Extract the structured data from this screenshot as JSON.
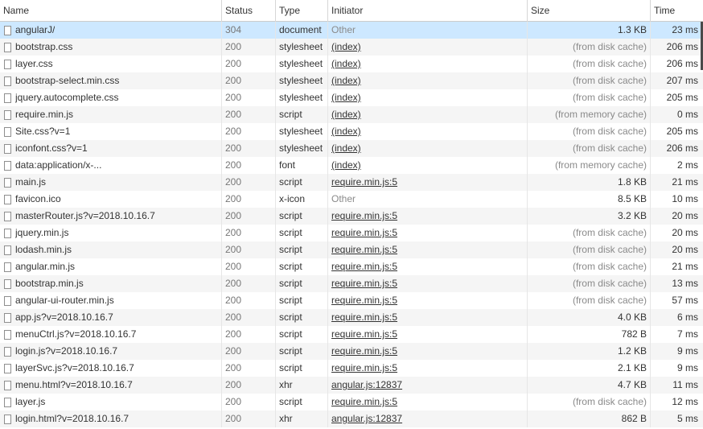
{
  "columns": {
    "name": "Name",
    "status": "Status",
    "type": "Type",
    "initiator": "Initiator",
    "size": "Size",
    "time": "Time"
  },
  "rows": [
    {
      "name": "angularJ/",
      "status": "304",
      "type": "document",
      "initiator": "Other",
      "init_link": false,
      "size": "1.3 KB",
      "size_muted": false,
      "time": "23 ms"
    },
    {
      "name": "bootstrap.css",
      "status": "200",
      "type": "stylesheet",
      "initiator": "(index)",
      "init_link": true,
      "size": "(from disk cache)",
      "size_muted": true,
      "time": "206 ms"
    },
    {
      "name": "layer.css",
      "status": "200",
      "type": "stylesheet",
      "initiator": "(index)",
      "init_link": true,
      "size": "(from disk cache)",
      "size_muted": true,
      "time": "206 ms"
    },
    {
      "name": "bootstrap-select.min.css",
      "status": "200",
      "type": "stylesheet",
      "initiator": "(index)",
      "init_link": true,
      "size": "(from disk cache)",
      "size_muted": true,
      "time": "207 ms"
    },
    {
      "name": "jquery.autocomplete.css",
      "status": "200",
      "type": "stylesheet",
      "initiator": "(index)",
      "init_link": true,
      "size": "(from disk cache)",
      "size_muted": true,
      "time": "205 ms"
    },
    {
      "name": "require.min.js",
      "status": "200",
      "type": "script",
      "initiator": "(index)",
      "init_link": true,
      "size": "(from memory cache)",
      "size_muted": true,
      "time": "0 ms"
    },
    {
      "name": "Site.css?v=1",
      "status": "200",
      "type": "stylesheet",
      "initiator": "(index)",
      "init_link": true,
      "size": "(from disk cache)",
      "size_muted": true,
      "time": "205 ms"
    },
    {
      "name": "iconfont.css?v=1",
      "status": "200",
      "type": "stylesheet",
      "initiator": "(index)",
      "init_link": true,
      "size": "(from disk cache)",
      "size_muted": true,
      "time": "206 ms"
    },
    {
      "name": "data:application/x-...",
      "status": "200",
      "type": "font",
      "initiator": "(index)",
      "init_link": true,
      "size": "(from memory cache)",
      "size_muted": true,
      "time": "2 ms"
    },
    {
      "name": "main.js",
      "status": "200",
      "type": "script",
      "initiator": "require.min.js:5",
      "init_link": true,
      "size": "1.8 KB",
      "size_muted": false,
      "time": "21 ms"
    },
    {
      "name": "favicon.ico",
      "status": "200",
      "type": "x-icon",
      "initiator": "Other",
      "init_link": false,
      "size": "8.5 KB",
      "size_muted": false,
      "time": "10 ms"
    },
    {
      "name": "masterRouter.js?v=2018.10.16.7",
      "status": "200",
      "type": "script",
      "initiator": "require.min.js:5",
      "init_link": true,
      "size": "3.2 KB",
      "size_muted": false,
      "time": "20 ms"
    },
    {
      "name": "jquery.min.js",
      "status": "200",
      "type": "script",
      "initiator": "require.min.js:5",
      "init_link": true,
      "size": "(from disk cache)",
      "size_muted": true,
      "time": "20 ms"
    },
    {
      "name": "lodash.min.js",
      "status": "200",
      "type": "script",
      "initiator": "require.min.js:5",
      "init_link": true,
      "size": "(from disk cache)",
      "size_muted": true,
      "time": "20 ms"
    },
    {
      "name": "angular.min.js",
      "status": "200",
      "type": "script",
      "initiator": "require.min.js:5",
      "init_link": true,
      "size": "(from disk cache)",
      "size_muted": true,
      "time": "21 ms"
    },
    {
      "name": "bootstrap.min.js",
      "status": "200",
      "type": "script",
      "initiator": "require.min.js:5",
      "init_link": true,
      "size": "(from disk cache)",
      "size_muted": true,
      "time": "13 ms"
    },
    {
      "name": "angular-ui-router.min.js",
      "status": "200",
      "type": "script",
      "initiator": "require.min.js:5",
      "init_link": true,
      "size": "(from disk cache)",
      "size_muted": true,
      "time": "57 ms"
    },
    {
      "name": "app.js?v=2018.10.16.7",
      "status": "200",
      "type": "script",
      "initiator": "require.min.js:5",
      "init_link": true,
      "size": "4.0 KB",
      "size_muted": false,
      "time": "6 ms"
    },
    {
      "name": "menuCtrl.js?v=2018.10.16.7",
      "status": "200",
      "type": "script",
      "initiator": "require.min.js:5",
      "init_link": true,
      "size": "782 B",
      "size_muted": false,
      "time": "7 ms"
    },
    {
      "name": "login.js?v=2018.10.16.7",
      "status": "200",
      "type": "script",
      "initiator": "require.min.js:5",
      "init_link": true,
      "size": "1.2 KB",
      "size_muted": false,
      "time": "9 ms"
    },
    {
      "name": "layerSvc.js?v=2018.10.16.7",
      "status": "200",
      "type": "script",
      "initiator": "require.min.js:5",
      "init_link": true,
      "size": "2.1 KB",
      "size_muted": false,
      "time": "9 ms"
    },
    {
      "name": "menu.html?v=2018.10.16.7",
      "status": "200",
      "type": "xhr",
      "initiator": "angular.js:12837",
      "init_link": true,
      "size": "4.7 KB",
      "size_muted": false,
      "time": "11 ms"
    },
    {
      "name": "layer.js",
      "status": "200",
      "type": "script",
      "initiator": "require.min.js:5",
      "init_link": true,
      "size": "(from disk cache)",
      "size_muted": true,
      "time": "12 ms"
    },
    {
      "name": "login.html?v=2018.10.16.7",
      "status": "200",
      "type": "xhr",
      "initiator": "angular.js:12837",
      "init_link": true,
      "size": "862 B",
      "size_muted": false,
      "time": "5 ms"
    }
  ],
  "selected_row": 0,
  "colors": {
    "selected_row": "#cde8ff",
    "alt_row": "#f5f5f5",
    "text": "#333333",
    "muted": "#8a8a8a"
  }
}
